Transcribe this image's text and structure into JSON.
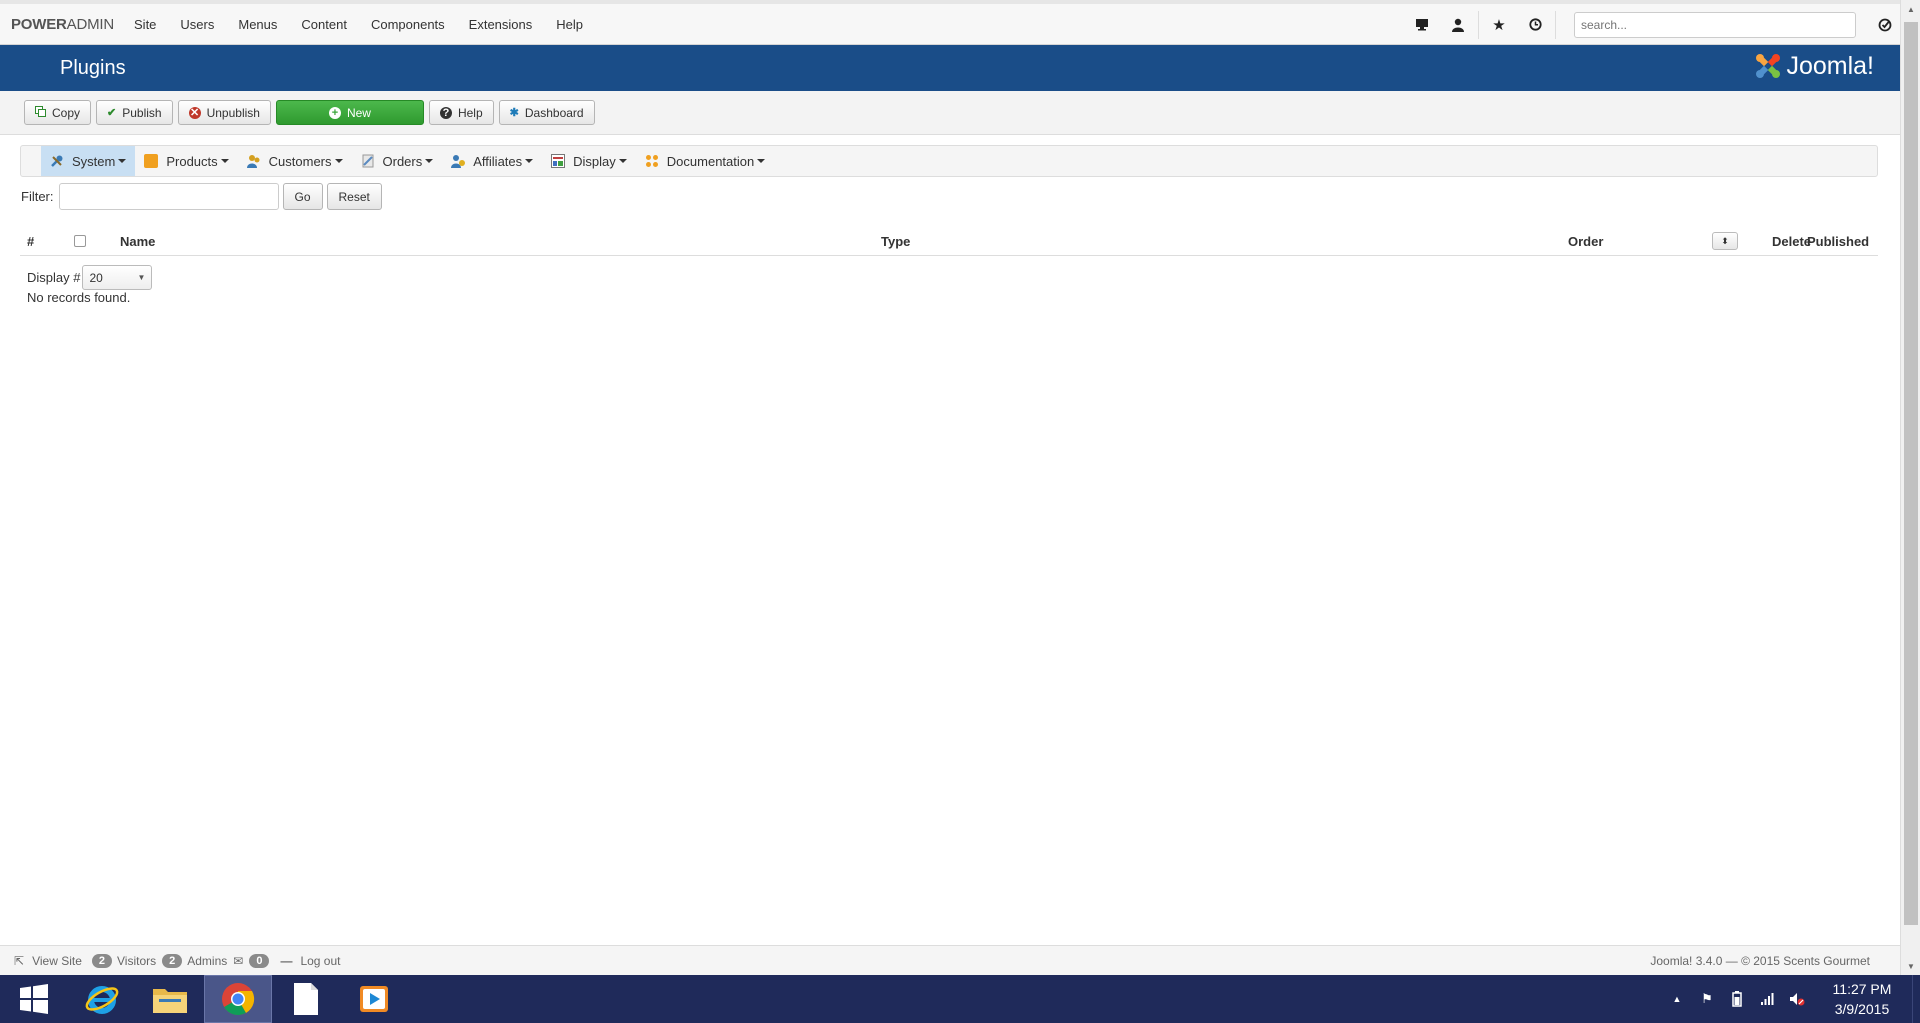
{
  "topnav": {
    "brand_bold": "POWER",
    "brand_light": "ADMIN",
    "menu": [
      "Site",
      "Users",
      "Menus",
      "Content",
      "Components",
      "Extensions",
      "Help"
    ],
    "search_placeholder": "search..."
  },
  "header": {
    "title": "Plugins",
    "logo_text": "Joomla!"
  },
  "toolbar": {
    "copy": "Copy",
    "publish": "Publish",
    "unpublish": "Unpublish",
    "new": "New",
    "help": "Help",
    "dashboard": "Dashboard"
  },
  "subnav": {
    "items": [
      "System",
      "Products",
      "Customers",
      "Orders",
      "Affiliates",
      "Display",
      "Documentation"
    ],
    "active": "System"
  },
  "filter": {
    "label": "Filter:",
    "value": "",
    "go": "Go",
    "reset": "Reset"
  },
  "table": {
    "headers": {
      "num": "#",
      "name": "Name",
      "type": "Type",
      "order": "Order",
      "delete": "Delete",
      "published": "Published"
    },
    "display_label": "Display #",
    "display_value": "20",
    "empty_message": "No records found."
  },
  "footer": {
    "view_site": "View Site",
    "visitors_count": "2",
    "visitors_label": "Visitors",
    "admins_count": "2",
    "admins_label": "Admins",
    "messages_count": "0",
    "logout": "Log out",
    "version": "Joomla! 3.4.0 — © 2015 Scents Gourmet"
  },
  "taskbar": {
    "time": "11:27 PM",
    "date": "3/9/2015"
  },
  "colors": {
    "header_bg": "#1a4d88",
    "new_button": "#3aa63a",
    "taskbar_bg": "#1f2a5a",
    "active_subnav": "#c8dff3"
  }
}
